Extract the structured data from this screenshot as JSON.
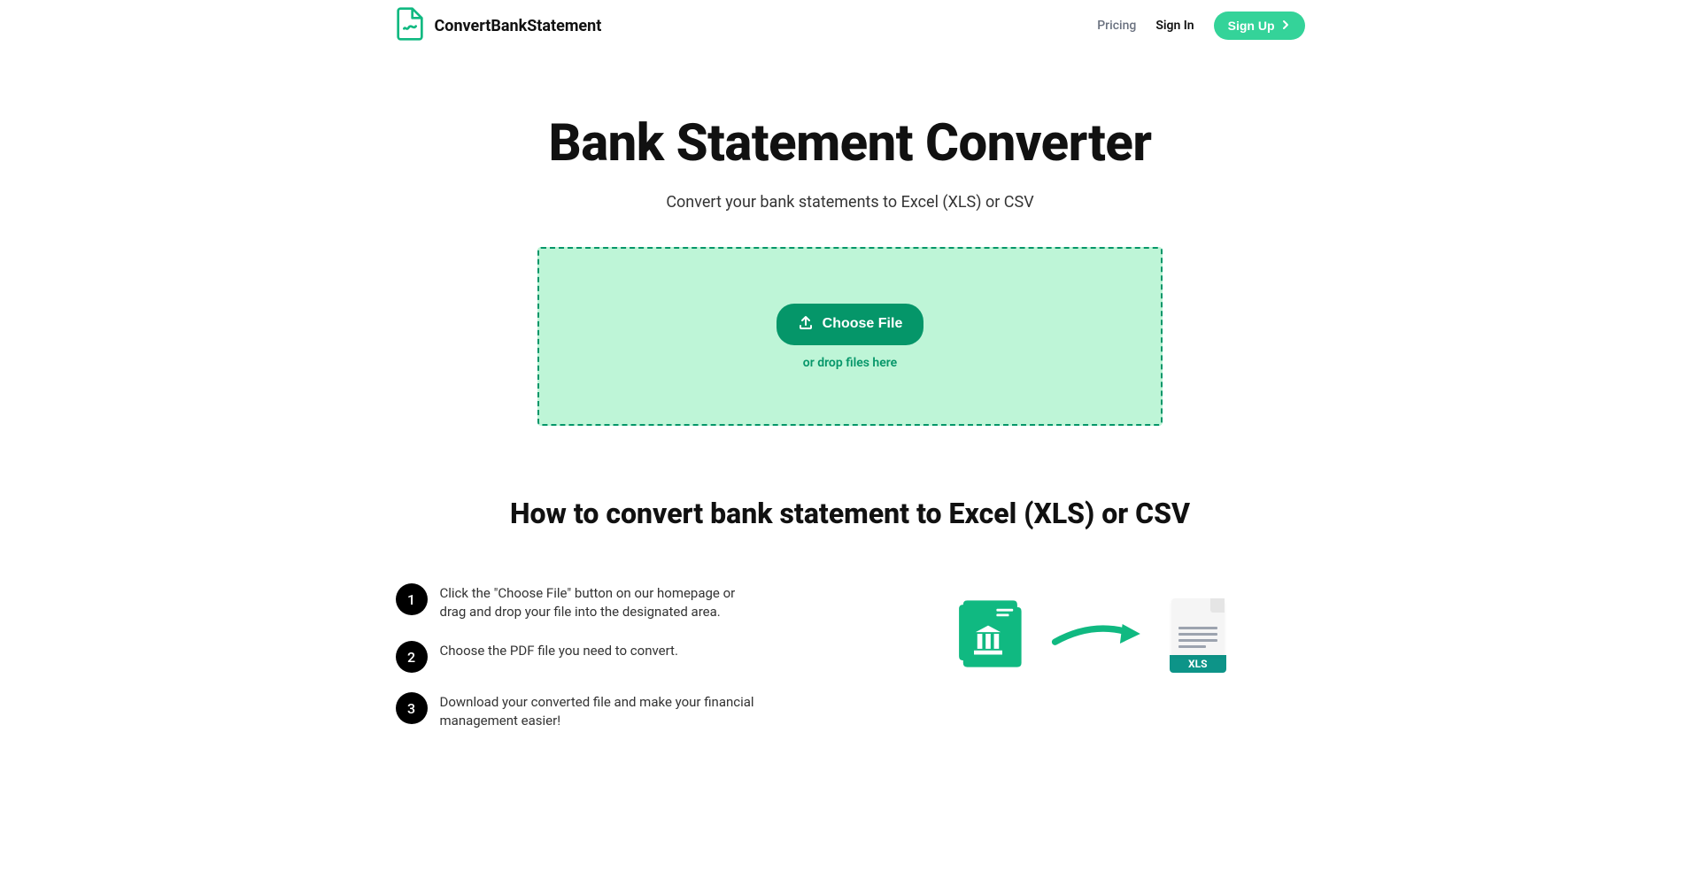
{
  "header": {
    "brand": "ConvertBankStatement",
    "nav": {
      "pricing": "Pricing",
      "signin": "Sign In",
      "signup": "Sign Up"
    }
  },
  "hero": {
    "title": "Bank Statement Converter",
    "subtitle": "Convert your bank statements to Excel (XLS) or CSV"
  },
  "upload": {
    "choose_file": "Choose File",
    "drop_hint": "or drop files here"
  },
  "howto": {
    "title": "How to convert bank statement to Excel (XLS) or CSV",
    "steps": [
      {
        "num": "1",
        "text": "Click the \"Choose File\" button on our homepage or drag and drop your file into the designated area."
      },
      {
        "num": "2",
        "text": "Choose the PDF file you need to convert."
      },
      {
        "num": "3",
        "text": "Download your converted file and make your financial management easier!"
      }
    ],
    "illustration": {
      "xls_label": "XLS"
    }
  }
}
